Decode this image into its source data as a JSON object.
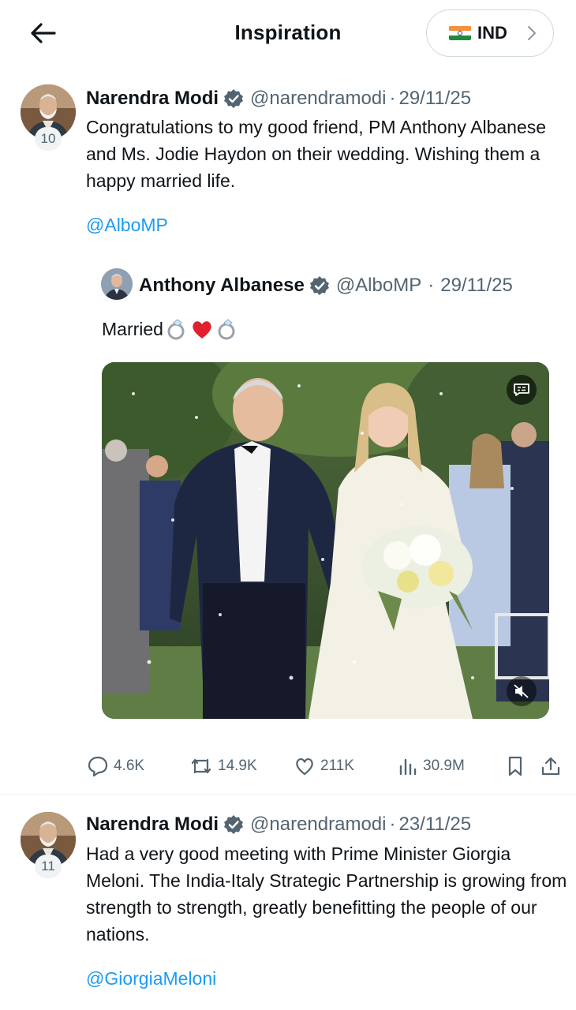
{
  "header": {
    "title": "Inspiration",
    "region": "IND"
  },
  "posts": [
    {
      "rank": "10",
      "author": "Narendra Modi",
      "handle": "@narendramodi",
      "separator": "·",
      "date": "29/11/25",
      "text": "Congratulations to my good friend, PM Anthony Albanese and Ms. Jodie Haydon on their wedding. Wishing them a happy married life.",
      "mention": "@AlboMP",
      "quote": {
        "author": "Anthony Albanese",
        "handle": "@AlboMP",
        "separator": "·",
        "date": "29/11/25",
        "text": "Married"
      },
      "stats": {
        "replies": "4.6K",
        "reposts": "14.9K",
        "likes": "211K",
        "views": "30.9M"
      }
    },
    {
      "rank": "11",
      "author": "Narendra Modi",
      "handle": "@narendramodi",
      "separator": "·",
      "date": "23/11/25",
      "text": "Had a very good meeting with Prime Minister Giorgia Meloni. The India-Italy Strategic Partnership is growing from strength to strength, greatly benefitting the people of our nations.",
      "mention": "@GiorgiaMeloni"
    }
  ],
  "icons": {
    "back": "arrow-left-icon",
    "region_flag": "india-flag-icon",
    "region_chevron": "chevron-right-icon",
    "verified": "verified-badge-icon",
    "ring": "ring-icon",
    "heart": "red-heart-icon",
    "captions": "captions-icon",
    "mute": "mute-icon",
    "reply": "comment-icon",
    "repost": "repost-icon",
    "like": "heart-icon",
    "views": "views-icon",
    "bookmark": "bookmark-icon",
    "share": "share-icon"
  },
  "colors": {
    "link": "#1d9bf0",
    "muted": "#536471",
    "text": "#0f1419",
    "heart": "#e0202f"
  }
}
